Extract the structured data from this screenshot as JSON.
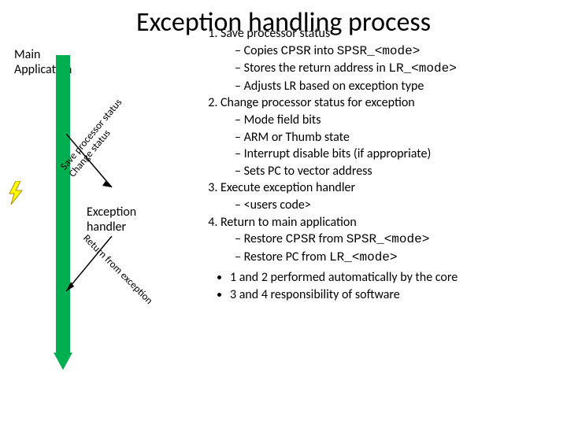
{
  "title": "Exception handling process",
  "mainApp": "Main\nApplication",
  "excHandler": "Exception\nhandler",
  "arrowLabels": {
    "saveLine1": "Save processor status",
    "saveLine2": "Change status",
    "return": "Return from exception"
  },
  "steps": {
    "s1": "Save processor status",
    "s1a_pre": "Copies ",
    "s1a_m1": "CPSR",
    "s1a_mid": " into ",
    "s1a_m2": "SPSR_<mode>",
    "s1b_pre": "Stores the return address in ",
    "s1b_m": "LR_<mode>",
    "s1c": "Adjusts LR based on exception type",
    "s2": "Change processor status for exception",
    "s2a": "Mode field bits",
    "s2b": "ARM or Thumb state",
    "s2c": "Interrupt disable bits (if appropriate)",
    "s2d": "Sets PC to vector address",
    "s3": "Execute exception handler",
    "s3a": "<users code>",
    "s4": "Return to main application",
    "s4a_pre": "Restore ",
    "s4a_m1": "CPSR",
    "s4a_mid": " from ",
    "s4a_m2": "SPSR_<mode>",
    "s4b_pre": "Restore PC from ",
    "s4b_m": "LR_<mode>",
    "n1": "1 and 2 performed automatically by the core",
    "n2": "3 and 4 responsibility of software"
  }
}
